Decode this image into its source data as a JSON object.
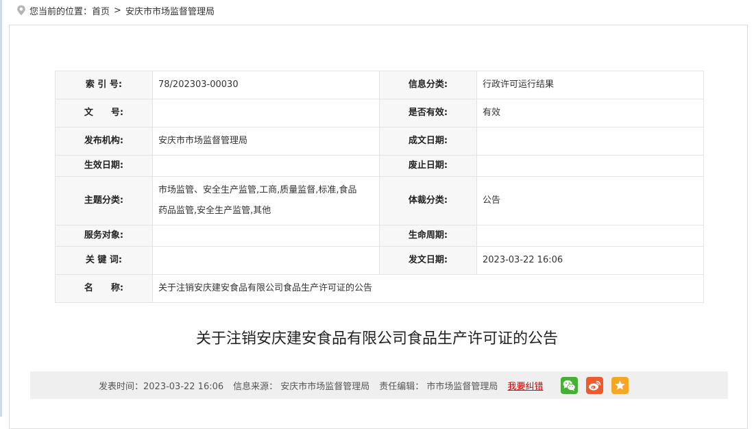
{
  "breadcrumb": {
    "prefix": "您当前的位置：",
    "home": "首页",
    "separator": ">",
    "current": "安庆市市场监督管理局"
  },
  "meta": {
    "index_label": "索 引 号:",
    "index_value": "78/202303-00030",
    "category_label": "信息分类:",
    "category_value": "行政许可运行结果",
    "docno_label": "文　　号:",
    "docno_value": "",
    "valid_label": "是否有效:",
    "valid_value": "有效",
    "issuer_label": "发布机构:",
    "issuer_value": "安庆市市场监督管理局",
    "written_label": "成文日期:",
    "written_value": "",
    "effective_label": "生效日期:",
    "effective_value": "",
    "abolish_label": "废止日期:",
    "abolish_value": "",
    "topic_label": "主题分类:",
    "topic_value_line1": "市场监管、安全生产监管,工商,质量监督,标准,食品",
    "topic_value_line2": "药品监管,安全生产监管,其他",
    "genre_label": "体裁分类:",
    "genre_value": "公告",
    "service_label": "服务对象:",
    "service_value": "",
    "lifecycle_label": "生命周期:",
    "lifecycle_value": "",
    "keyword_label": "关 键 词:",
    "keyword_value": "",
    "pubdate_label": "发文日期:",
    "pubdate_value": "2023-03-22 16:06",
    "name_label": "名　　称:",
    "name_value": "关于注销安庆建安食品有限公司食品生产许可证的公告"
  },
  "article": {
    "title": "关于注销安庆建安食品有限公司食品生产许可证的公告"
  },
  "info_bar": {
    "publish_time": "发表时间：2023-03-22 16:06",
    "source": "信息来源：  安庆市市场监督管理局",
    "editor": "责任编辑：  市市场监督管理局",
    "report_error": "我要纠错"
  },
  "colors": {
    "wechat": "#46b034",
    "weibo": "#f0592b",
    "favorite": "#f5a623",
    "error_link": "#d40000"
  }
}
